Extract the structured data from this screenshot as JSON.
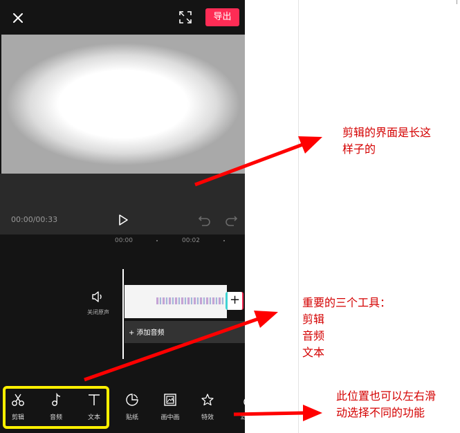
{
  "header": {
    "export_label": "导出"
  },
  "player": {
    "time": "00:00/00:33"
  },
  "timeline": {
    "ticks": [
      "00:00",
      "00:02"
    ],
    "mute_label": "关闭原声",
    "clip_add": "+",
    "audio_label": "+  添加音频"
  },
  "toolbar": {
    "items": [
      {
        "label": "剪辑",
        "icon": "scissors-icon"
      },
      {
        "label": "音频",
        "icon": "music-note-icon"
      },
      {
        "label": "文本",
        "icon": "text-icon"
      },
      {
        "label": "贴纸",
        "icon": "sticker-icon"
      },
      {
        "label": "画中画",
        "icon": "picture-in-picture-icon"
      },
      {
        "label": "特效",
        "icon": "star-effect-icon"
      },
      {
        "label": "滤",
        "icon": "filter-icon"
      }
    ]
  },
  "annotations": {
    "editor_ui_line1": "剪辑的界面是长这",
    "editor_ui_line2": "样子的",
    "tools_line1": "重要的三个工具：",
    "tools_line2": "剪辑",
    "tools_line3": "音频",
    "tools_line4": "文本",
    "scroll_line1": "此位置也可以左右滑",
    "scroll_line2": "动选择不同的功能"
  },
  "colors": {
    "accent": "#fe2c55",
    "highlight": "#fff000",
    "annotation": "#d40000",
    "background": "#141414"
  }
}
